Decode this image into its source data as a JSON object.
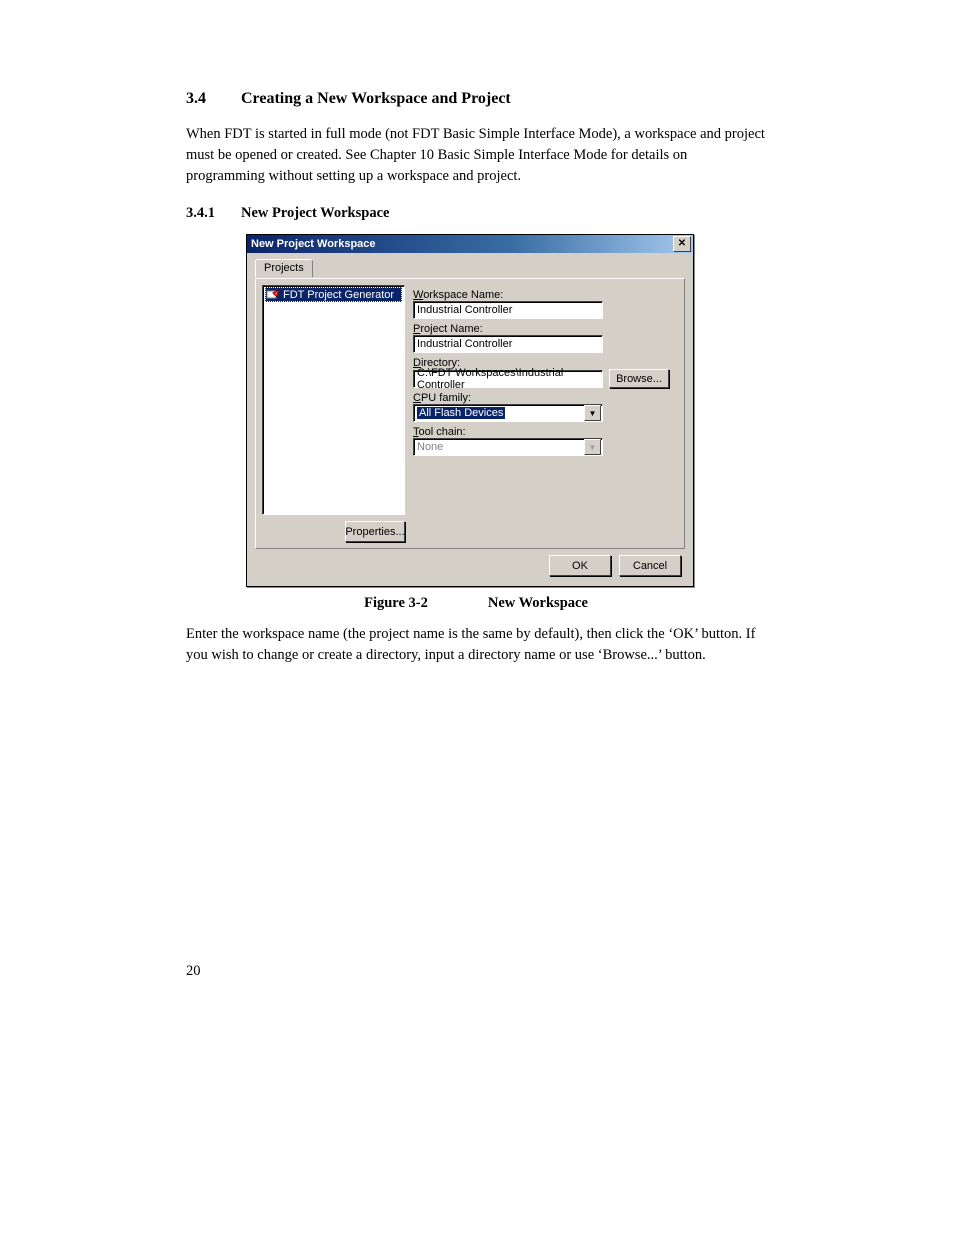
{
  "section": {
    "number": "3.4",
    "title": "Creating a New Workspace and Project",
    "para1": "When FDT is started in full mode (not FDT Basic Simple Interface Mode), a workspace and project must be opened or created. See Chapter 10 Basic Simple Interface Mode for details on programming without setting up a workspace and project."
  },
  "subsection": {
    "number": "3.4.1",
    "title": "New Project Workspace"
  },
  "dialog": {
    "title": "New Project Workspace",
    "close_tooltip": "Close",
    "tab": "Projects",
    "list": {
      "item0": "FDT Project Generator"
    },
    "labels": {
      "workspace": "orkspace Name:",
      "project": "roject Name:",
      "directory": "irectory:",
      "cpu": "PU family:",
      "tool": "ool chain:"
    },
    "underline": {
      "workspace": "W",
      "project": "P",
      "directory": "D",
      "cpu": "C",
      "tool": "T",
      "browse": "B"
    },
    "values": {
      "workspace": "Industrial Controller",
      "project": "Industrial Controller",
      "directory": "C:\\FDT Workspaces\\Industrial Controller",
      "cpu": "All Flash Devices",
      "tool": "None"
    },
    "buttons": {
      "browse": "rowse...",
      "properties": "Properties...",
      "ok": "OK",
      "cancel": "Cancel"
    }
  },
  "figure": {
    "label": "Figure 3-2",
    "caption": "New Workspace"
  },
  "post_text": "Enter the workspace name (the project name is the same by default), then click the ‘OK’ button. If you wish to change or create a directory, input a directory name or use ‘Browse...’ button.",
  "page_number": "20"
}
